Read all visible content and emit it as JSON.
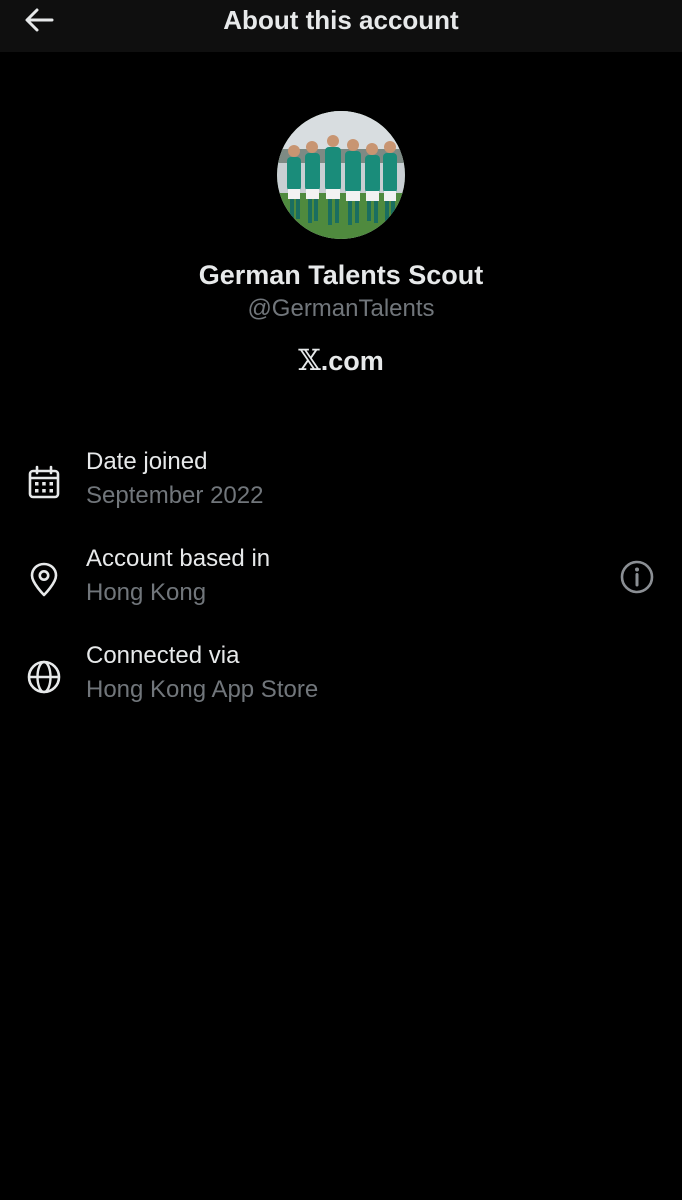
{
  "header": {
    "back_icon": "arrow-left-icon",
    "title": "About this account"
  },
  "profile": {
    "avatar_description": "team-photo-avatar",
    "display_name": "German Talents Scout",
    "handle": "@GermanTalents",
    "platform_x": "𝕏",
    "platform_suffix": ".com"
  },
  "details": [
    {
      "icon": "calendar-icon",
      "label": "Date joined",
      "value": "September 2022"
    },
    {
      "icon": "location-pin-icon",
      "label": "Account based in",
      "value": "Hong Kong",
      "info_icon": "info-icon"
    },
    {
      "icon": "globe-icon",
      "label": "Connected via",
      "value": "Hong Kong App Store"
    }
  ],
  "colors": {
    "background": "#000000",
    "header_background": "#0f0f0f",
    "primary_text": "#e7e9ea",
    "secondary_text": "#71767b"
  }
}
